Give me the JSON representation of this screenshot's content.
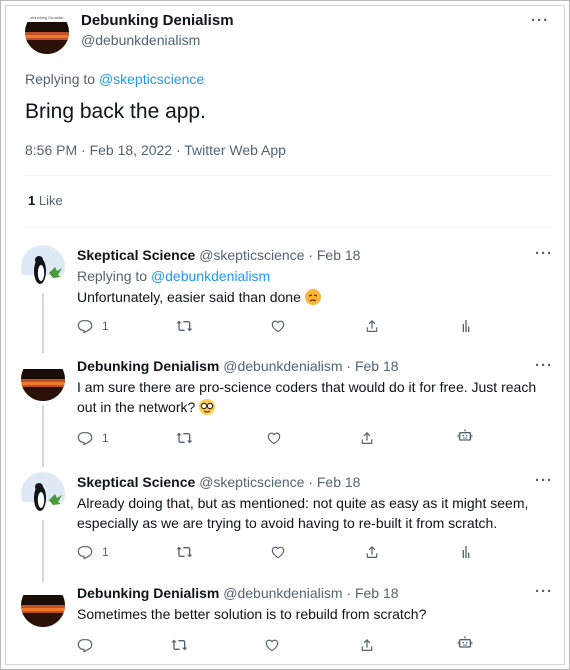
{
  "main_tweet": {
    "author_name": "Debunking Denialism",
    "author_handle": "@debunkdenialism",
    "replying_prefix": "Replying to",
    "replying_to": "@skepticscience",
    "text": "Bring back the app.",
    "timestamp": "8:56 PM · Feb 18, 2022 · Twitter Web App",
    "like_count": "1",
    "like_label": "Like"
  },
  "replies": [
    {
      "author_name": "Skeptical Science",
      "meta": "@skepticscience · Feb 18",
      "replying_prefix": "Replying to",
      "replying_to": "@debunkdenialism",
      "text_lines": [
        "Unfortunately, easier said than done"
      ],
      "reply_count": "1"
    },
    {
      "author_name": "Debunking Denialism",
      "meta": "@debunkdenialism · Feb 18",
      "text_lines": [
        "I am sure there are pro-science coders that would do it for free. Just reach",
        "out in the network?"
      ],
      "reply_count": "1"
    },
    {
      "author_name": "Skeptical Science",
      "meta": "@skepticscience · Feb 18",
      "text_lines": [
        "Already doing that, but as mentioned: not quite as easy as it might seem,",
        "especially as we are trying to avoid having to re-built it from scratch."
      ],
      "reply_count": "1"
    },
    {
      "author_name": "Debunking Denialism",
      "meta": "@debunkdenialism · Feb 18",
      "text_lines": [
        "Sometimes the better solution is to rebuild from scratch?"
      ],
      "reply_count": ""
    }
  ],
  "more_label": "···",
  "avatar_dd_text": "Debunking Denialism",
  "colors": {
    "text": "#0f1419",
    "secondary": "#536471",
    "link": "#1d9bf0",
    "divider": "#eff3f4"
  },
  "icons": [
    "more-icon",
    "reply-icon",
    "retweet-icon",
    "like-icon",
    "share-icon",
    "analytics-icon",
    "bot-icon",
    "disappointed-emoji",
    "nerd-emoji"
  ]
}
